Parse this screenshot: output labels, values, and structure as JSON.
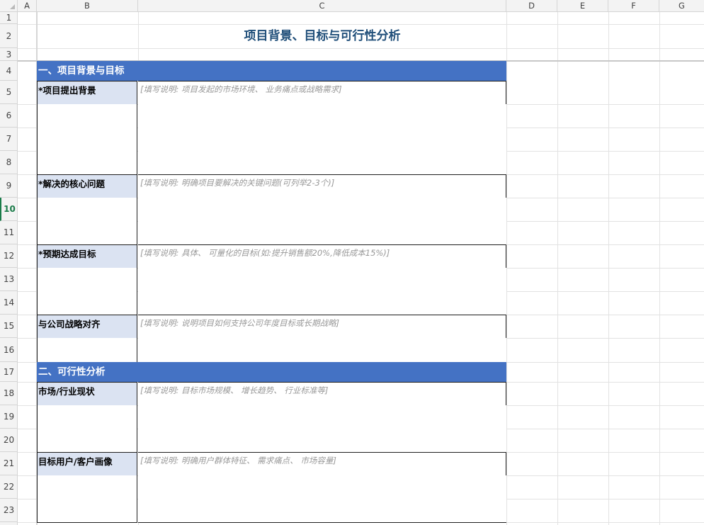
{
  "columns": [
    "A",
    "B",
    "C",
    "D",
    "E",
    "F",
    "G"
  ],
  "rows": [
    "1",
    "2",
    "3",
    "4",
    "5",
    "6",
    "7",
    "8",
    "9",
    "10",
    "11",
    "12",
    "13",
    "14",
    "15",
    "16",
    "17",
    "18",
    "19",
    "20",
    "21",
    "22",
    "23"
  ],
  "active_row": "10",
  "title": "项目背景、目标与可行性分析",
  "sections": [
    {
      "header": "一、项目背景与目标"
    },
    {
      "header": "二、可行性分析"
    }
  ],
  "fields": [
    {
      "label": "*项目提出背景",
      "hint": "[填写说明: 项目发起的市场环境、 业务痛点或战略需求]"
    },
    {
      "label": "*解决的核心问题",
      "hint": "[填写说明: 明确项目要解决的关键问题(可列举2-3个)]"
    },
    {
      "label": "*预期达成目标",
      "hint": "[填写说明: 具体、 可量化的目标(如:提升销售额20%,降低成本15%)]"
    },
    {
      "label": "与公司战略对齐",
      "hint": "[填写说明: 说明项目如何支持公司年度目标或长期战略]"
    },
    {
      "label": "市场/行业现状",
      "hint": "[填写说明: 目标市场规模、 增长趋势、 行业标准等]"
    },
    {
      "label": "目标用户/客户画像",
      "hint": "[填写说明: 明确用户群体特征、 需求痛点、 市场容量]"
    }
  ],
  "colors": {
    "section_bg": "#4472c4",
    "label_bg": "#dbe3f2",
    "title": "#1f4e79",
    "active": "#1b7c4a"
  }
}
